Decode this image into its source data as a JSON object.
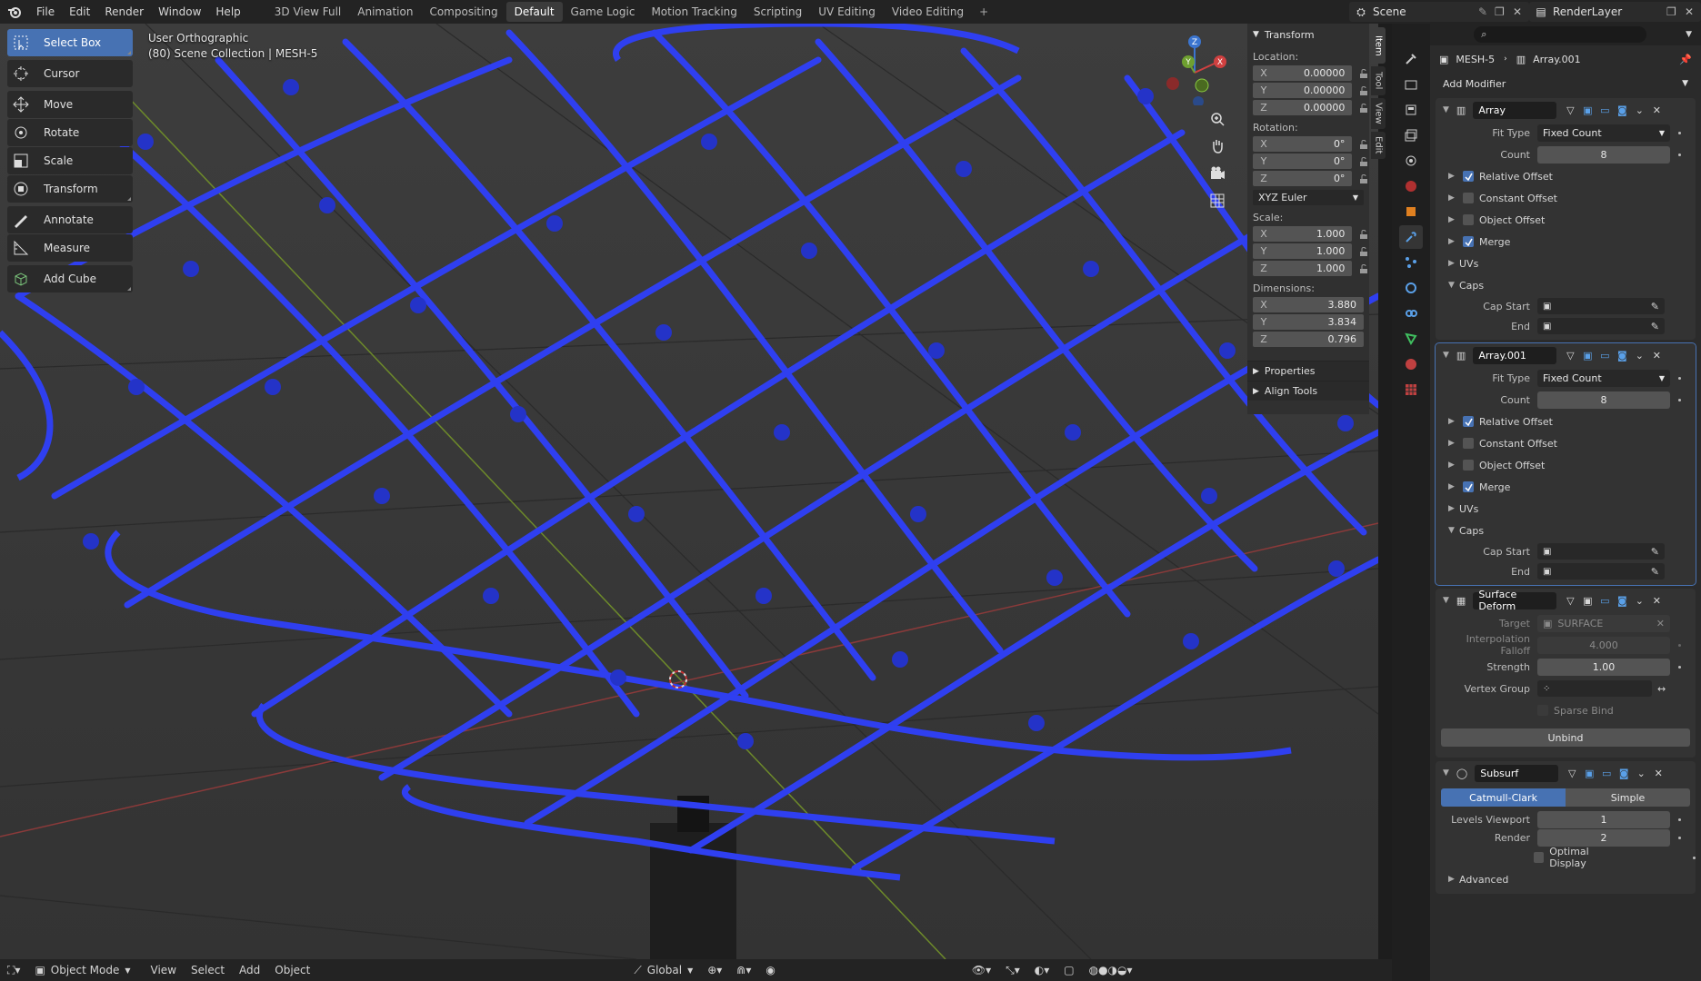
{
  "menu": [
    "File",
    "Edit",
    "Render",
    "Window",
    "Help"
  ],
  "workspaces": [
    "3D View Full",
    "Animation",
    "Compositing",
    "Default",
    "Game Logic",
    "Motion Tracking",
    "Scripting",
    "UV Editing",
    "Video Editing"
  ],
  "active_workspace": "Default",
  "add_workspace": "+",
  "scene": "Scene",
  "render_layer": "RenderLayer",
  "viewport": {
    "view_name": "User Orthographic",
    "collection": "(80) Scene Collection | MESH-5"
  },
  "tools": [
    {
      "label": "Select Box",
      "icon": "select-box-icon"
    },
    {
      "label": "Cursor",
      "icon": "cursor-icon"
    },
    {
      "label": "Move",
      "icon": "move-icon"
    },
    {
      "label": "Rotate",
      "icon": "rotate-icon"
    },
    {
      "label": "Scale",
      "icon": "scale-icon"
    },
    {
      "label": "Transform",
      "icon": "transform-icon"
    },
    {
      "label": "Annotate",
      "icon": "annotate-icon"
    },
    {
      "label": "Measure",
      "icon": "measure-icon"
    },
    {
      "label": "Add Cube",
      "icon": "add-cube-icon"
    }
  ],
  "gizmo": {
    "x": "X",
    "y": "Y",
    "z": "Z"
  },
  "npanel": {
    "title": "Transform",
    "location_label": "Location:",
    "location": [
      {
        "axis": "X",
        "value": "0.00000"
      },
      {
        "axis": "Y",
        "value": "0.00000"
      },
      {
        "axis": "Z",
        "value": "0.00000"
      }
    ],
    "rotation_label": "Rotation:",
    "rotation": [
      {
        "axis": "X",
        "value": "0°"
      },
      {
        "axis": "Y",
        "value": "0°"
      },
      {
        "axis": "Z",
        "value": "0°"
      }
    ],
    "rotation_mode": "XYZ Euler",
    "scale_label": "Scale:",
    "scale": [
      {
        "axis": "X",
        "value": "1.000"
      },
      {
        "axis": "Y",
        "value": "1.000"
      },
      {
        "axis": "Z",
        "value": "1.000"
      }
    ],
    "dimensions_label": "Dimensions:",
    "dimensions": [
      {
        "axis": "X",
        "value": "3.880"
      },
      {
        "axis": "Y",
        "value": "3.834"
      },
      {
        "axis": "Z",
        "value": "0.796"
      }
    ],
    "properties": "Properties",
    "align_tools": "Align Tools",
    "tabs": [
      "Item",
      "Tool",
      "View",
      "Edit"
    ]
  },
  "bottom": {
    "mode": "Object Mode",
    "menus": [
      "View",
      "Select",
      "Add",
      "Object"
    ],
    "orientation": "Global"
  },
  "properties": {
    "object": "MESH-5",
    "modifier": "Array.001",
    "add_modifier": "Add Modifier",
    "labels": {
      "fit_type": "Fit Type",
      "count": "Count",
      "relative_offset": "Relative Offset",
      "constant_offset": "Constant Offset",
      "object_offset": "Object Offset",
      "merge": "Merge",
      "uvs": "UVs",
      "caps": "Caps",
      "cap_start": "Cap Start",
      "end": "End"
    },
    "array1": {
      "name": "Array",
      "fit_type": "Fixed Count",
      "count": "8"
    },
    "array2": {
      "name": "Array.001",
      "fit_type": "Fixed Count",
      "count": "8"
    },
    "surface_deform": {
      "name": "Surface Deform",
      "target_label": "Target",
      "target": "SURFACE",
      "falloff_label": "Interpolation Falloff",
      "falloff": "4.000",
      "strength_label": "Strength",
      "strength": "1.00",
      "vgroup_label": "Vertex Group",
      "sparse_bind": "Sparse Bind",
      "unbind": "Unbind"
    },
    "subsurf": {
      "name": "Subsurf",
      "catmull": "Catmull-Clark",
      "simple": "Simple",
      "levels_label": "Levels Viewport",
      "levels": "1",
      "render_label": "Render",
      "render": "2",
      "optimal": "Optimal Display",
      "advanced": "Advanced"
    }
  },
  "colors": {
    "accent": "#4772b3",
    "mesh": "#2f3ff0",
    "viewport_bg": "#393939"
  }
}
